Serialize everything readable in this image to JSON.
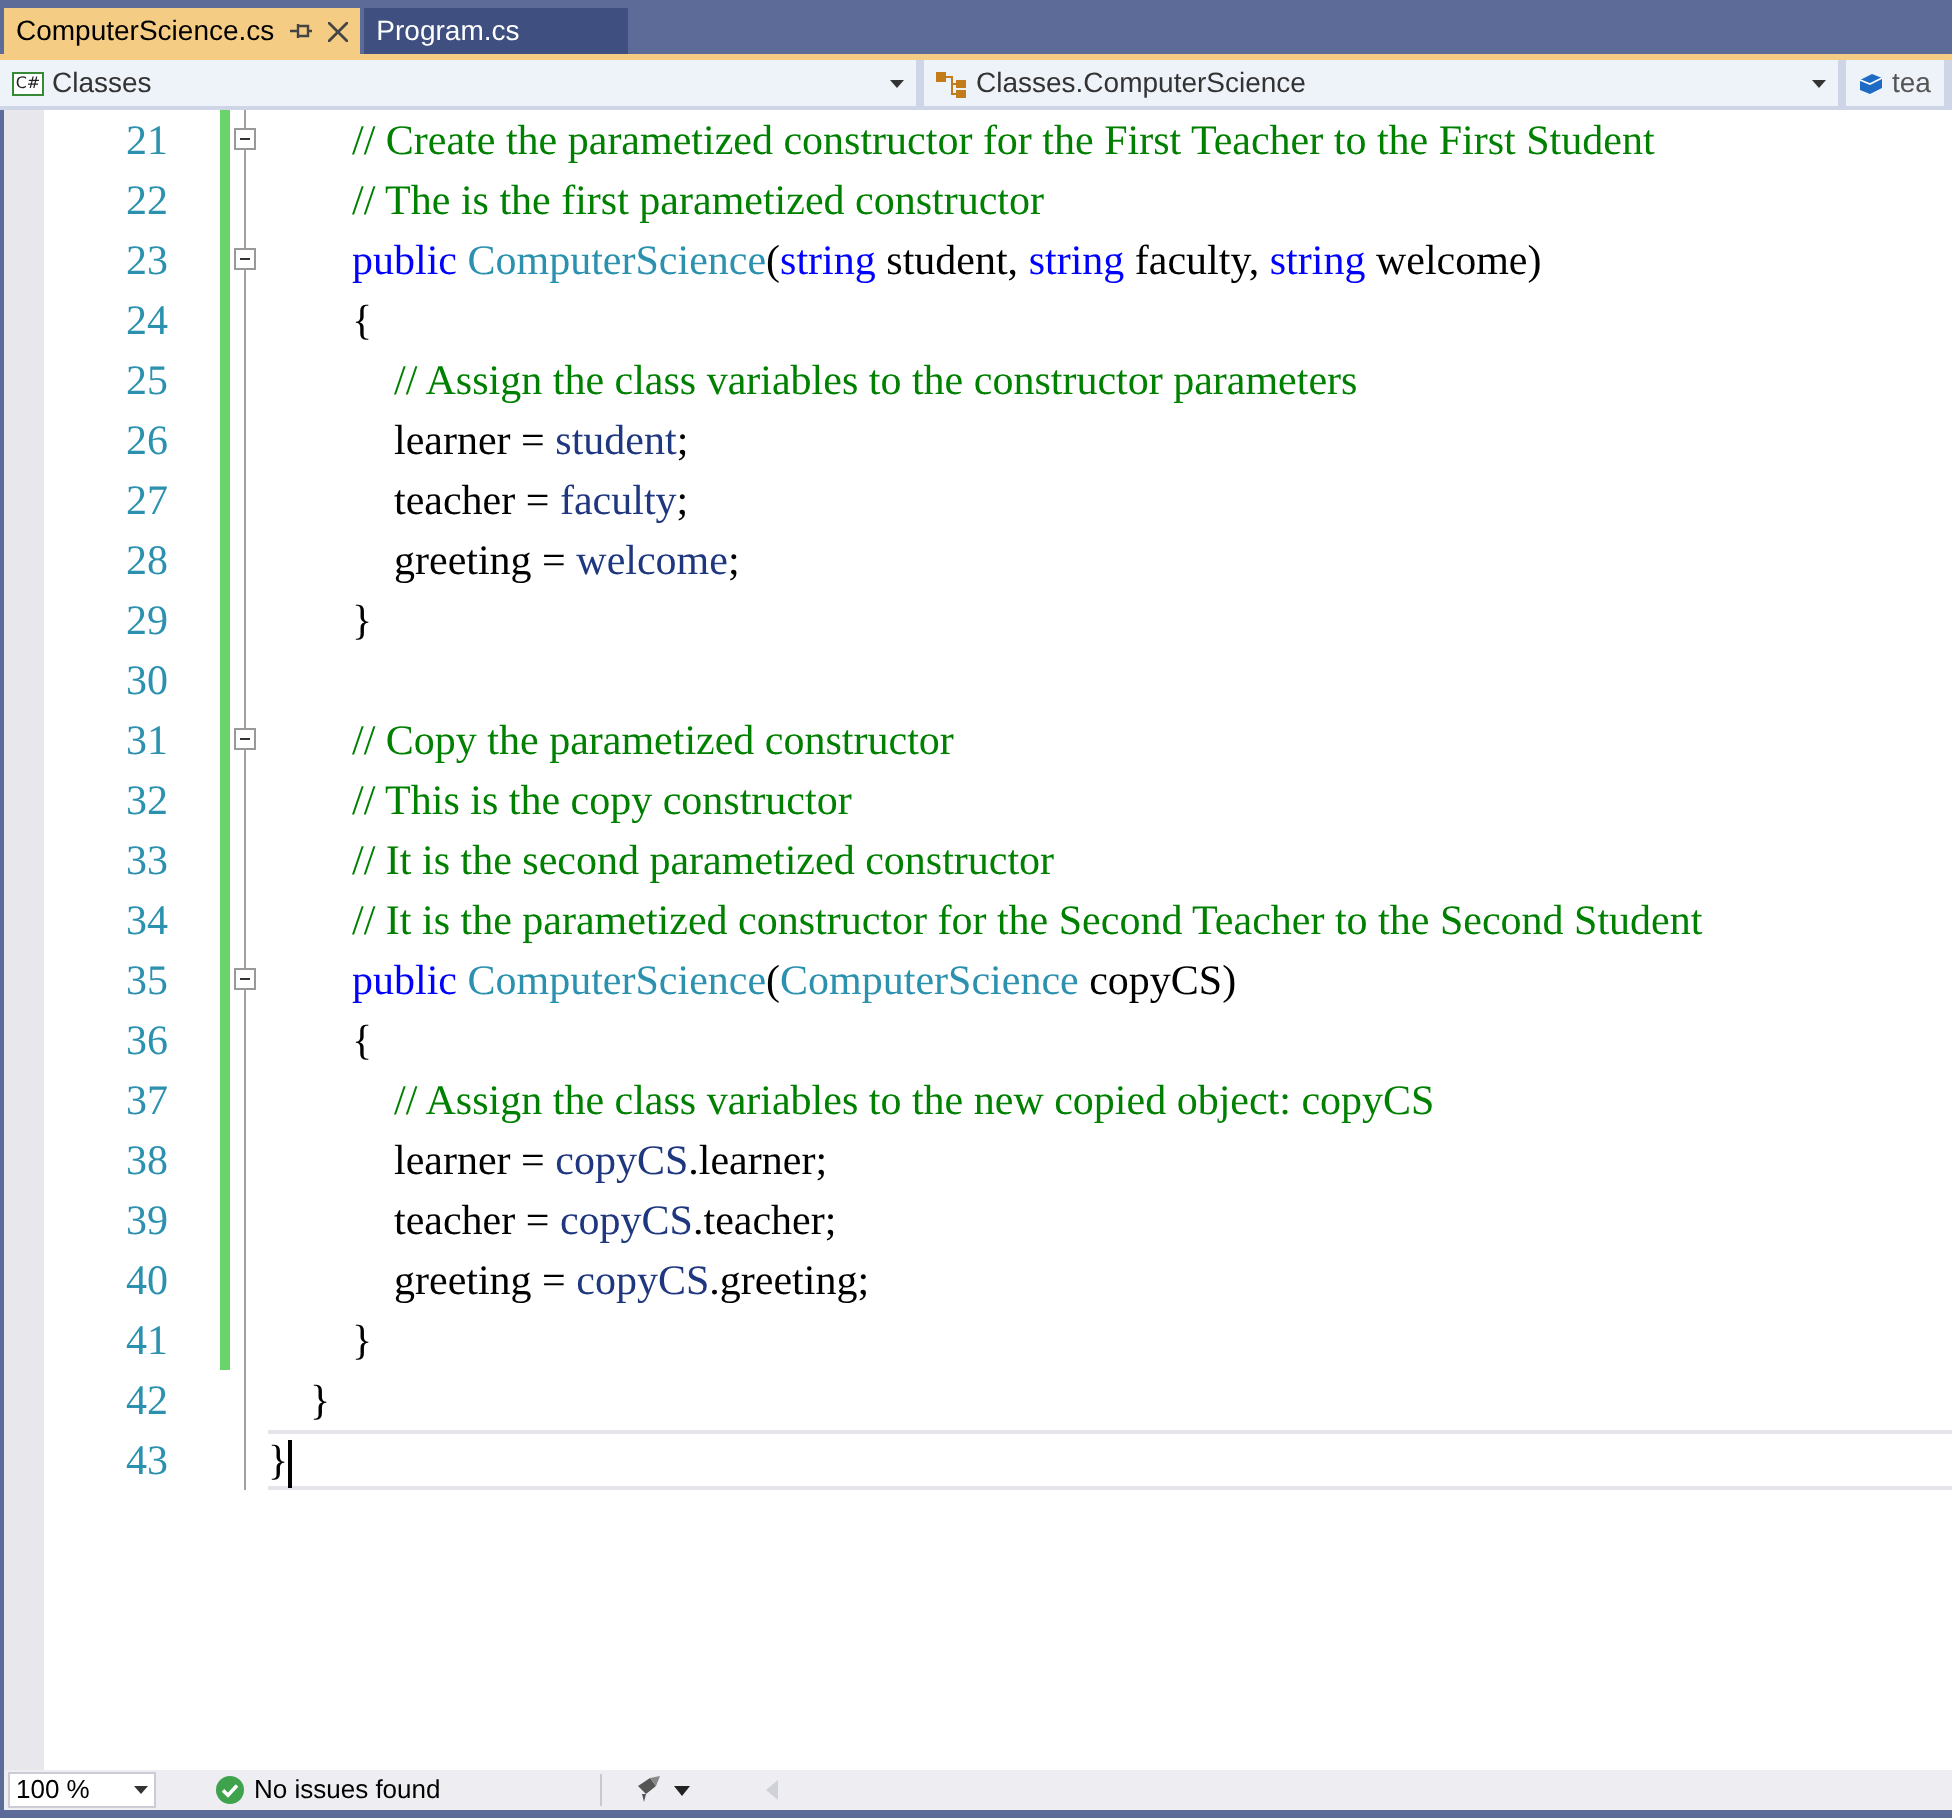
{
  "tabs": [
    {
      "label": "ComputerScience.cs",
      "selected": true
    },
    {
      "label": "Program.cs",
      "selected": false
    }
  ],
  "nav_bar": [
    {
      "kind": "project",
      "icon_text": "C#",
      "label": "Classes"
    },
    {
      "kind": "class",
      "label": "Classes.ComputerScience"
    },
    {
      "kind": "member",
      "label": "tea"
    }
  ],
  "code_lines": [
    {
      "number": "21",
      "fold": true,
      "changed": true,
      "current": false,
      "tokens": [
        {
          "kind": "comment",
          "text": "        // Create the parametized constructor for the First Teacher to the First Student"
        }
      ]
    },
    {
      "number": "22",
      "fold": false,
      "changed": true,
      "current": false,
      "tokens": [
        {
          "kind": "comment",
          "text": "        // The is the first parametized constructor"
        }
      ]
    },
    {
      "number": "23",
      "fold": true,
      "changed": true,
      "current": false,
      "tokens": [
        {
          "kind": "keyword",
          "text": "        public "
        },
        {
          "kind": "type",
          "text": "ComputerScience"
        },
        {
          "kind": "plain",
          "text": "("
        },
        {
          "kind": "keyword",
          "text": "string"
        },
        {
          "kind": "plain",
          "text": " student, "
        },
        {
          "kind": "keyword",
          "text": "string"
        },
        {
          "kind": "plain",
          "text": " faculty, "
        },
        {
          "kind": "keyword",
          "text": "string"
        },
        {
          "kind": "plain",
          "text": " welcome)"
        }
      ]
    },
    {
      "number": "24",
      "fold": false,
      "changed": true,
      "current": false,
      "tokens": [
        {
          "kind": "plain",
          "text": "        {"
        }
      ]
    },
    {
      "number": "25",
      "fold": false,
      "changed": true,
      "current": false,
      "tokens": [
        {
          "kind": "comment",
          "text": "            // Assign the class variables to the constructor parameters"
        }
      ]
    },
    {
      "number": "26",
      "fold": false,
      "changed": true,
      "current": false,
      "tokens": [
        {
          "kind": "plain",
          "text": "            learner = "
        },
        {
          "kind": "param",
          "text": "student"
        },
        {
          "kind": "plain",
          "text": ";"
        }
      ]
    },
    {
      "number": "27",
      "fold": false,
      "changed": true,
      "current": false,
      "tokens": [
        {
          "kind": "plain",
          "text": "            teacher = "
        },
        {
          "kind": "param",
          "text": "faculty"
        },
        {
          "kind": "plain",
          "text": ";"
        }
      ]
    },
    {
      "number": "28",
      "fold": false,
      "changed": true,
      "current": false,
      "tokens": [
        {
          "kind": "plain",
          "text": "            greeting = "
        },
        {
          "kind": "param",
          "text": "welcome"
        },
        {
          "kind": "plain",
          "text": ";"
        }
      ]
    },
    {
      "number": "29",
      "fold": false,
      "changed": true,
      "current": false,
      "tokens": [
        {
          "kind": "plain",
          "text": "        }"
        }
      ]
    },
    {
      "number": "30",
      "fold": false,
      "changed": true,
      "current": false
    },
    {
      "number": "31",
      "fold": true,
      "changed": true,
      "current": false,
      "tokens": [
        {
          "kind": "comment",
          "text": "        // Copy the parametized constructor"
        }
      ]
    },
    {
      "number": "32",
      "fold": false,
      "changed": true,
      "current": false,
      "tokens": [
        {
          "kind": "comment",
          "text": "        // This is the copy constructor"
        }
      ]
    },
    {
      "number": "33",
      "fold": false,
      "changed": true,
      "current": false,
      "tokens": [
        {
          "kind": "comment",
          "text": "        // It is the second parametized constructor"
        }
      ]
    },
    {
      "number": "34",
      "fold": false,
      "changed": true,
      "current": false,
      "tokens": [
        {
          "kind": "comment",
          "text": "        // It is the parametized constructor for the Second Teacher to the Second Student"
        }
      ]
    },
    {
      "number": "35",
      "fold": true,
      "changed": true,
      "current": false,
      "tokens": [
        {
          "kind": "keyword",
          "text": "        public "
        },
        {
          "kind": "type",
          "text": "ComputerScience"
        },
        {
          "kind": "plain",
          "text": "("
        },
        {
          "kind": "type",
          "text": "ComputerScience"
        },
        {
          "kind": "plain",
          "text": " copyCS)"
        }
      ]
    },
    {
      "number": "36",
      "fold": false,
      "changed": true,
      "current": false,
      "tokens": [
        {
          "kind": "plain",
          "text": "        {"
        }
      ]
    },
    {
      "number": "37",
      "fold": false,
      "changed": true,
      "current": false,
      "tokens": [
        {
          "kind": "comment",
          "text": "            // Assign the class variables to the new copied object: copyCS"
        }
      ]
    },
    {
      "number": "38",
      "fold": false,
      "changed": true,
      "current": false,
      "tokens": [
        {
          "kind": "plain",
          "text": "            learner = "
        },
        {
          "kind": "param",
          "text": "copyCS"
        },
        {
          "kind": "plain",
          "text": ".learner;"
        }
      ]
    },
    {
      "number": "39",
      "fold": false,
      "changed": true,
      "current": false,
      "tokens": [
        {
          "kind": "plain",
          "text": "            teacher = "
        },
        {
          "kind": "param",
          "text": "copyCS"
        },
        {
          "kind": "plain",
          "text": ".teacher;"
        }
      ]
    },
    {
      "number": "40",
      "fold": false,
      "changed": true,
      "current": false,
      "tokens": [
        {
          "kind": "plain",
          "text": "            greeting = "
        },
        {
          "kind": "param",
          "text": "copyCS"
        },
        {
          "kind": "plain",
          "text": ".greeting;"
        }
      ]
    },
    {
      "number": "41",
      "fold": false,
      "changed": true,
      "current": false,
      "tokens": [
        {
          "kind": "plain",
          "text": "        }"
        }
      ]
    },
    {
      "number": "42",
      "fold": false,
      "changed": false,
      "current": false,
      "tokens": [
        {
          "kind": "plain",
          "text": "    }"
        }
      ]
    },
    {
      "number": "43",
      "fold": false,
      "changed": false,
      "current": true,
      "tokens": [
        {
          "kind": "plain",
          "text": "}"
        }
      ]
    }
  ],
  "status_bar": {
    "zoom": "100 %",
    "issues": "No issues found"
  }
}
